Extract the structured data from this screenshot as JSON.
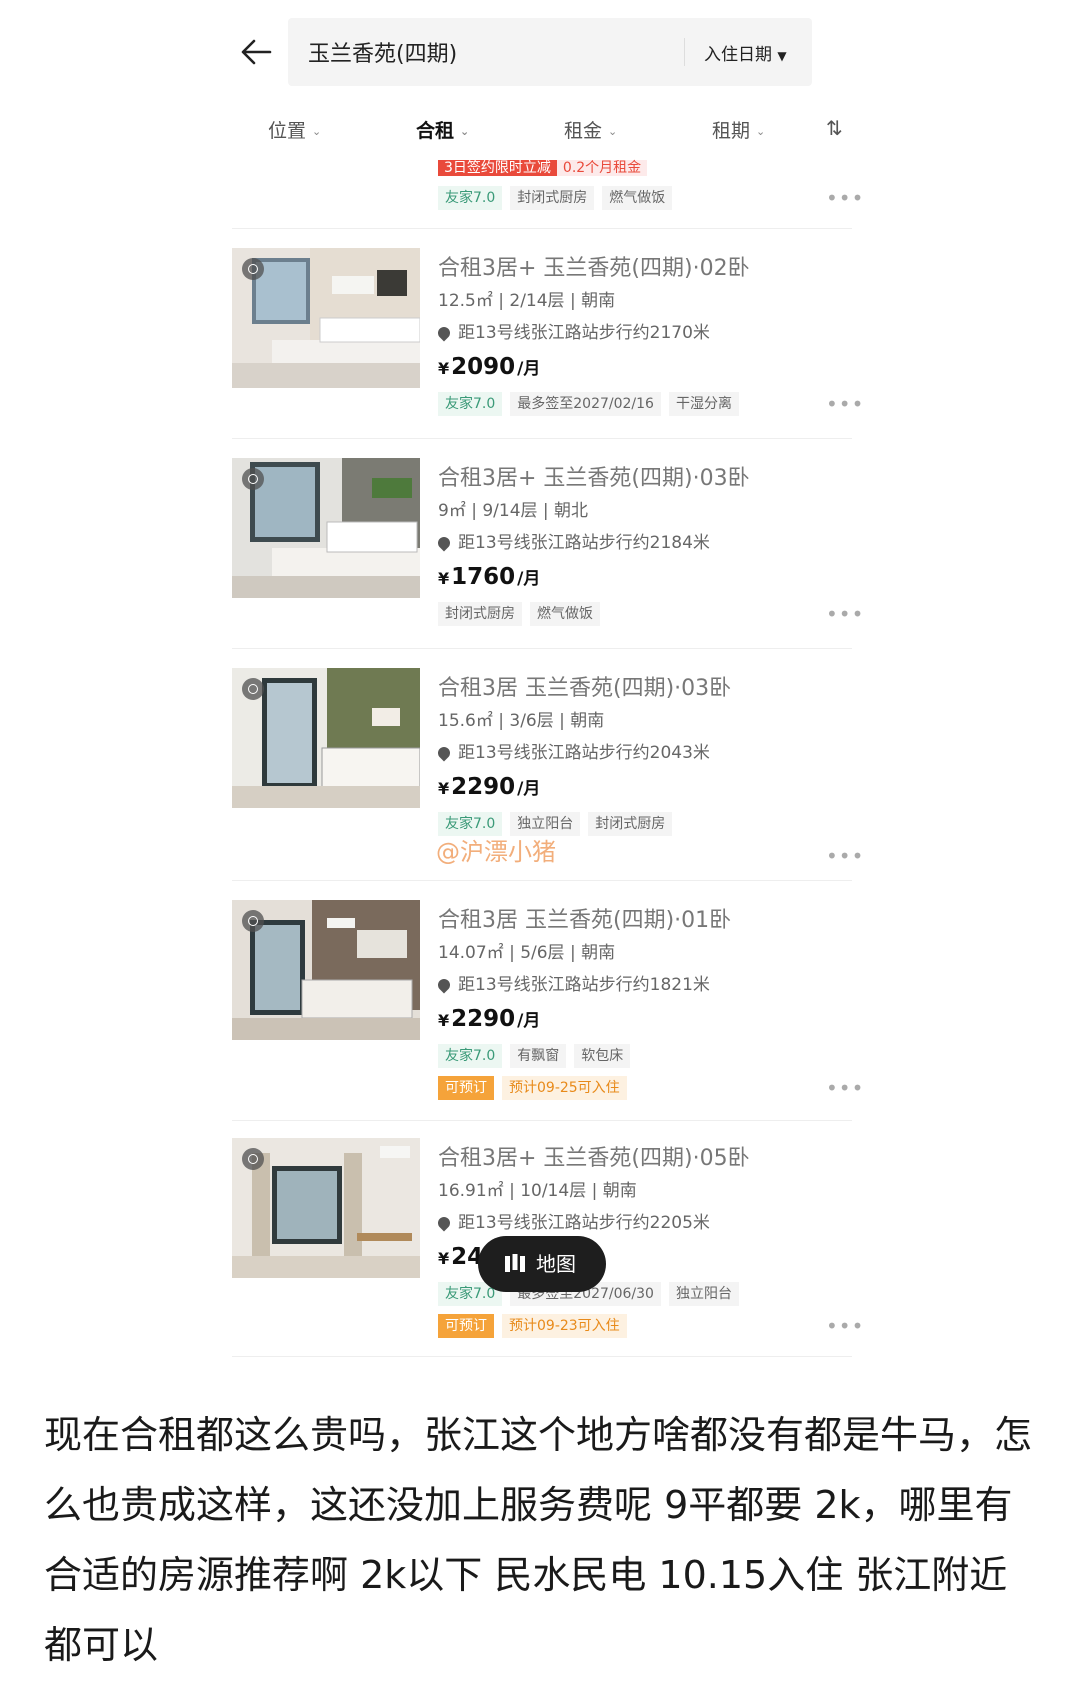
{
  "header": {
    "search_text": "玉兰香苑(四期)",
    "date_filter": "入住日期"
  },
  "filters": [
    {
      "label": "位置"
    },
    {
      "label": "合租"
    },
    {
      "label": "租金"
    },
    {
      "label": "租期"
    }
  ],
  "sort_icon": "⇅",
  "top_partial": {
    "promo_main": "3日签约限时立减",
    "promo_amount": "0.2个月租金",
    "tags": [
      "友家7.0",
      "封闭式厨房",
      "燃气做饭"
    ]
  },
  "listings": [
    {
      "title": "合租3居+ 玉兰香苑(四期)·02卧",
      "meta": "12.5㎡ | 2/14层 | 朝南",
      "location": "距13号线张江路站步行约2170米",
      "price": "2090",
      "tags": [
        "友家7.0",
        "最多签至2027/02/16",
        "干湿分离"
      ],
      "tags2": []
    },
    {
      "title": "合租3居+ 玉兰香苑(四期)·03卧",
      "meta": "9㎡ | 9/14层 | 朝北",
      "location": "距13号线张江路站步行约2184米",
      "price": "1760",
      "tags": [
        "封闭式厨房",
        "燃气做饭"
      ],
      "tags2": []
    },
    {
      "title": "合租3居 玉兰香苑(四期)·03卧",
      "meta": "15.6㎡ | 3/6层 | 朝南",
      "location": "距13号线张江路站步行约2043米",
      "price": "2290",
      "tags": [
        "友家7.0",
        "独立阳台",
        "封闭式厨房"
      ],
      "tags2": []
    },
    {
      "title": "合租3居 玉兰香苑(四期)·01卧",
      "meta": "14.07㎡ | 5/6层 | 朝南",
      "location": "距13号线张江路站步行约1821米",
      "price": "2290",
      "tags": [
        "友家7.0",
        "有飘窗",
        "软包床"
      ],
      "tags2": [
        "可预订",
        "预计09-25可入住"
      ]
    },
    {
      "title": "合租3居+ 玉兰香苑(四期)·05卧",
      "meta": "16.91㎡ | 10/14层 | 朝南",
      "location": "距13号线张江路站步行约2205米",
      "price": "2460",
      "tags": [
        "友家7.0",
        "最多签至2027/06/30",
        "独立阳台"
      ],
      "tags2": [
        "可预订",
        "预计09-23可入住"
      ]
    }
  ],
  "price_yen": "¥",
  "price_unit": "/月",
  "more_label": "•••",
  "map_button": "地图",
  "watermark": "@沪漂小猪",
  "caption": "现在合租都这么贵吗，张江这个地方啥都没有都是牛马，怎么也贵成这样，这还没加上服务费呢 9平都要 2k，哪里有合适的房源推荐啊 2k以下 民水民电 10.15入住 张江附近都可以",
  "colors": {
    "promo_red": "#e94a3b",
    "tag_green": "#3a9a78",
    "tag_orange": "#f5a33a",
    "map_button_bg": "#1e1e1e"
  }
}
